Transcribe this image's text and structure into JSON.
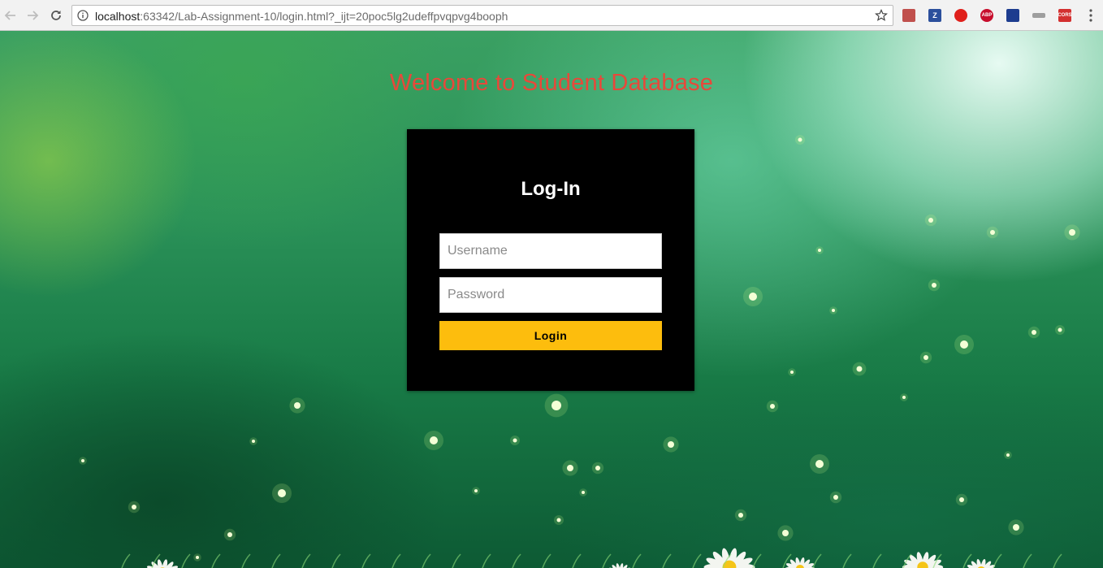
{
  "browser": {
    "url_host": "localhost",
    "url_rest": ":63342/Lab-Assignment-10/login.html?_ijt=20poc5lg2udeffpvqpvg4booph",
    "extensions": [
      {
        "name": "pdf-extension-icon",
        "label": "",
        "color": "#c0504d"
      },
      {
        "name": "zotero-extension-icon",
        "label": "Z",
        "color": "#2b4f9c"
      },
      {
        "name": "opera-extension-icon",
        "label": "",
        "color": "#e0201b"
      },
      {
        "name": "adblock-extension-icon",
        "label": "ABP",
        "color": "#c70d2c"
      },
      {
        "name": "vpn-extension-icon",
        "label": "",
        "color": "#1d3c8f"
      },
      {
        "name": "gray-extension-icon",
        "label": "",
        "color": "#9e9e9e"
      },
      {
        "name": "cors-extension-icon",
        "label": "CORS",
        "color": "#d32f2f"
      }
    ]
  },
  "page": {
    "welcome": "Welcome to Student Database",
    "login": {
      "title": "Log-In",
      "username_placeholder": "Username",
      "password_placeholder": "Password",
      "button_label": "Login"
    }
  },
  "colors": {
    "welcome_text": "#e8483a",
    "login_button": "#fdbd0d",
    "login_box": "#000000"
  }
}
